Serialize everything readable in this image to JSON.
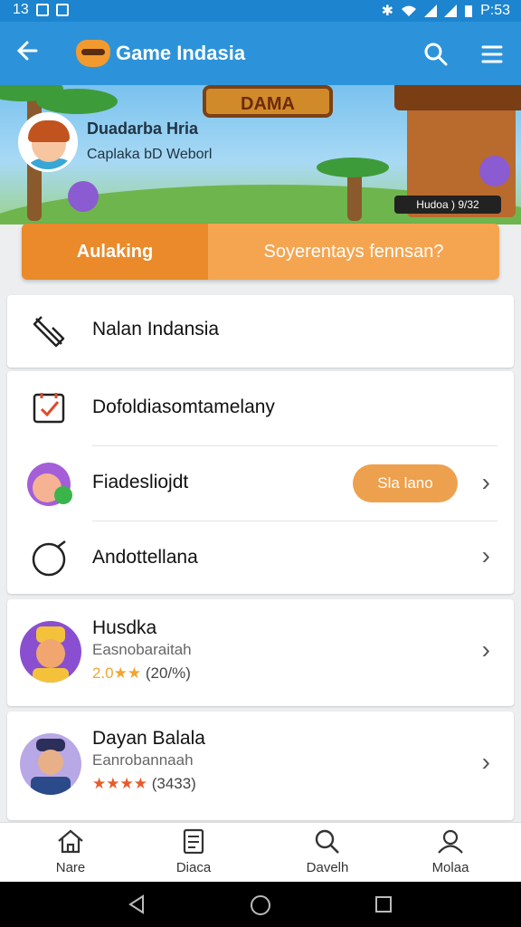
{
  "status_bar": {
    "time_left": "13",
    "time_right": "P:53"
  },
  "app_bar": {
    "title": "Game Indasia"
  },
  "hero": {
    "sign": "DAMA",
    "user_name": "Duadarba Hria",
    "user_sub": "Caplaka bD Weborl",
    "badge": "Hudoa ) 9/32"
  },
  "tabs": {
    "active": "Aulaking",
    "inactive": "Soyerentays fennsan?"
  },
  "menu": {
    "item1": "Nalan Indansia",
    "item2": "Dofoldiasomtamelany",
    "item3": "Fiadesliojdt",
    "item3_button": "Sla lano",
    "item4": "Andottellana"
  },
  "games": [
    {
      "title": "Husdka",
      "subtitle": "Easnobaraitah",
      "rating": "2.0",
      "count": "(20/%)"
    },
    {
      "title": "Dayan Balala",
      "subtitle": "Eanrobannaah",
      "rating": "",
      "count": "(3433)"
    }
  ],
  "bottom_nav": [
    {
      "label": "Nare",
      "icon": "home-icon"
    },
    {
      "label": "Diaca",
      "icon": "document-icon"
    },
    {
      "label": "Davelh",
      "icon": "search-icon"
    },
    {
      "label": "Molaa",
      "icon": "profile-icon"
    }
  ],
  "colors": {
    "primary": "#2c93da",
    "accent": "#ea8a2b",
    "accent_light": "#f5a550",
    "star": "#f0a533"
  }
}
